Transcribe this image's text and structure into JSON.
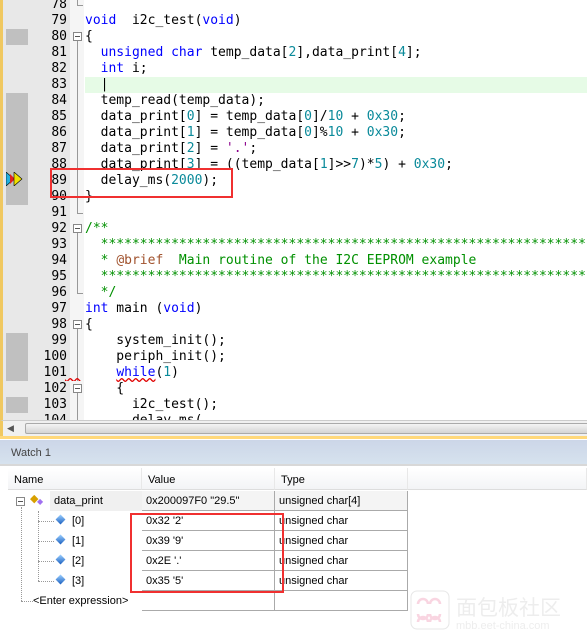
{
  "editor": {
    "current_line": 83,
    "execution_line": 89,
    "lines": [
      {
        "n": 78,
        "fold": "end",
        "segs": []
      },
      {
        "n": 79,
        "segs": [
          [
            "kw",
            "void"
          ],
          [
            "",
            "  i2c_test("
          ],
          [
            "kw",
            "void"
          ],
          [
            "",
            ")"
          ]
        ]
      },
      {
        "n": 80,
        "fold": "open",
        "bp": true,
        "segs": [
          [
            "",
            "{"
          ]
        ]
      },
      {
        "n": 81,
        "fold": "line",
        "segs": [
          [
            "",
            "  "
          ],
          [
            "kw",
            "unsigned char"
          ],
          [
            "",
            " temp_data["
          ],
          [
            "num",
            "2"
          ],
          [
            "",
            "],data_print["
          ],
          [
            "num",
            "4"
          ],
          [
            "",
            "];"
          ]
        ]
      },
      {
        "n": 82,
        "fold": "line",
        "segs": [
          [
            "",
            "  "
          ],
          [
            "kw",
            "int"
          ],
          [
            "",
            " i;"
          ]
        ]
      },
      {
        "n": 83,
        "fold": "line",
        "cur": true,
        "segs": [
          [
            "",
            "  |"
          ]
        ]
      },
      {
        "n": 84,
        "fold": "line",
        "bp": true,
        "segs": [
          [
            "",
            "  temp_read(temp_data);"
          ]
        ]
      },
      {
        "n": 85,
        "fold": "line",
        "bp": true,
        "segs": [
          [
            "",
            "  data_print["
          ],
          [
            "num",
            "0"
          ],
          [
            "",
            "] = temp_data["
          ],
          [
            "num",
            "0"
          ],
          [
            "",
            "]/"
          ],
          [
            "num",
            "10"
          ],
          [
            "",
            " + "
          ],
          [
            "num",
            "0x30"
          ],
          [
            "",
            ";"
          ]
        ]
      },
      {
        "n": 86,
        "fold": "line",
        "bp": true,
        "segs": [
          [
            "",
            "  data_print["
          ],
          [
            "num",
            "1"
          ],
          [
            "",
            "] = temp_data["
          ],
          [
            "num",
            "0"
          ],
          [
            "",
            "]%"
          ],
          [
            "num",
            "10"
          ],
          [
            "",
            " + "
          ],
          [
            "num",
            "0x30"
          ],
          [
            "",
            ";"
          ]
        ]
      },
      {
        "n": 87,
        "fold": "line",
        "bp": true,
        "segs": [
          [
            "",
            "  data_print["
          ],
          [
            "num",
            "2"
          ],
          [
            "",
            "] = "
          ],
          [
            "str",
            "'.'"
          ],
          [
            "",
            ";"
          ]
        ]
      },
      {
        "n": 88,
        "fold": "line",
        "bp": true,
        "segs": [
          [
            "",
            "  data_print["
          ],
          [
            "num",
            "3"
          ],
          [
            "",
            "] = ((temp_data["
          ],
          [
            "num",
            "1"
          ],
          [
            "",
            "]>>"
          ],
          [
            "num",
            "7"
          ],
          [
            "",
            ")*"
          ],
          [
            "num",
            "5"
          ],
          [
            "",
            ") + "
          ],
          [
            "num",
            "0x30"
          ],
          [
            "",
            ";"
          ]
        ]
      },
      {
        "n": 89,
        "fold": "line",
        "bp": true,
        "segs": [
          [
            "",
            "  delay_ms("
          ],
          [
            "num",
            "2000"
          ],
          [
            "",
            ");"
          ]
        ]
      },
      {
        "n": 90,
        "fold": "line",
        "bp": true,
        "segs": [
          [
            "",
            "}"
          ]
        ]
      },
      {
        "n": 91,
        "fold": "end",
        "segs": []
      },
      {
        "n": 92,
        "fold": "open",
        "segs": [
          [
            "cm",
            "/**"
          ]
        ]
      },
      {
        "n": 93,
        "fold": "line",
        "segs": [
          [
            "stars",
            "  **************************************************************"
          ]
        ]
      },
      {
        "n": 94,
        "fold": "line",
        "segs": [
          [
            "stars",
            "  * "
          ],
          [
            "doc",
            "@brief"
          ],
          [
            "cm",
            "  Main routine of the I2C EEPROM example"
          ]
        ]
      },
      {
        "n": 95,
        "fold": "line",
        "segs": [
          [
            "stars",
            "  **************************************************************"
          ]
        ]
      },
      {
        "n": 96,
        "fold": "end",
        "segs": [
          [
            "cm",
            "  */"
          ]
        ]
      },
      {
        "n": 97,
        "segs": [
          [
            "kw",
            "int"
          ],
          [
            "",
            " main ("
          ],
          [
            "kw",
            "void"
          ],
          [
            "",
            ")"
          ]
        ]
      },
      {
        "n": 98,
        "fold": "open",
        "segs": [
          [
            "",
            "{"
          ]
        ]
      },
      {
        "n": 99,
        "fold": "line",
        "bp": true,
        "segs": [
          [
            "",
            "    system_init();"
          ]
        ]
      },
      {
        "n": 100,
        "fold": "line",
        "bp": true,
        "segs": [
          [
            "",
            "    periph_init();"
          ]
        ]
      },
      {
        "n": 101,
        "fold": "line",
        "bp": true,
        "squig": true,
        "segs": [
          [
            "",
            "    "
          ],
          [
            "kw",
            "while"
          ],
          [
            "",
            "("
          ],
          [
            "num",
            "1"
          ],
          [
            "",
            ")"
          ]
        ]
      },
      {
        "n": 102,
        "fold": "open",
        "segs": [
          [
            "",
            "    {"
          ]
        ]
      },
      {
        "n": 103,
        "fold": "line",
        "bp": true,
        "segs": [
          [
            "",
            "      i2c_test();"
          ]
        ]
      },
      {
        "n": 104,
        "fold": "line",
        "segs": [
          [
            "",
            "      delay_ms("
          ]
        ]
      }
    ]
  },
  "watch": {
    "title": "Watch 1",
    "columns": [
      "Name",
      "Value",
      "Type"
    ],
    "rows": [
      {
        "name": "data_print",
        "value": "0x200097F0 \"29.5\"",
        "type": "unsigned char[4]",
        "level": 0,
        "expanded": true
      },
      {
        "name": "[0]",
        "value": "0x32 '2'",
        "type": "unsigned char",
        "level": 1
      },
      {
        "name": "[1]",
        "value": "0x39 '9'",
        "type": "unsigned char",
        "level": 1
      },
      {
        "name": "[2]",
        "value": "0x2E '.'",
        "type": "unsigned char",
        "level": 1
      },
      {
        "name": "[3]",
        "value": "0x35 '5'",
        "type": "unsigned char",
        "level": 1
      }
    ],
    "enter_expression": "<Enter expression>"
  },
  "watermark": {
    "name": "面包板社区",
    "url": "mbb.eet-china.com"
  },
  "colors": {
    "highlight_box": "#f03030",
    "keyword": "#0000ff",
    "number": "#0a8a9a",
    "comment": "#009000",
    "current_line": "#e6fbe6"
  }
}
